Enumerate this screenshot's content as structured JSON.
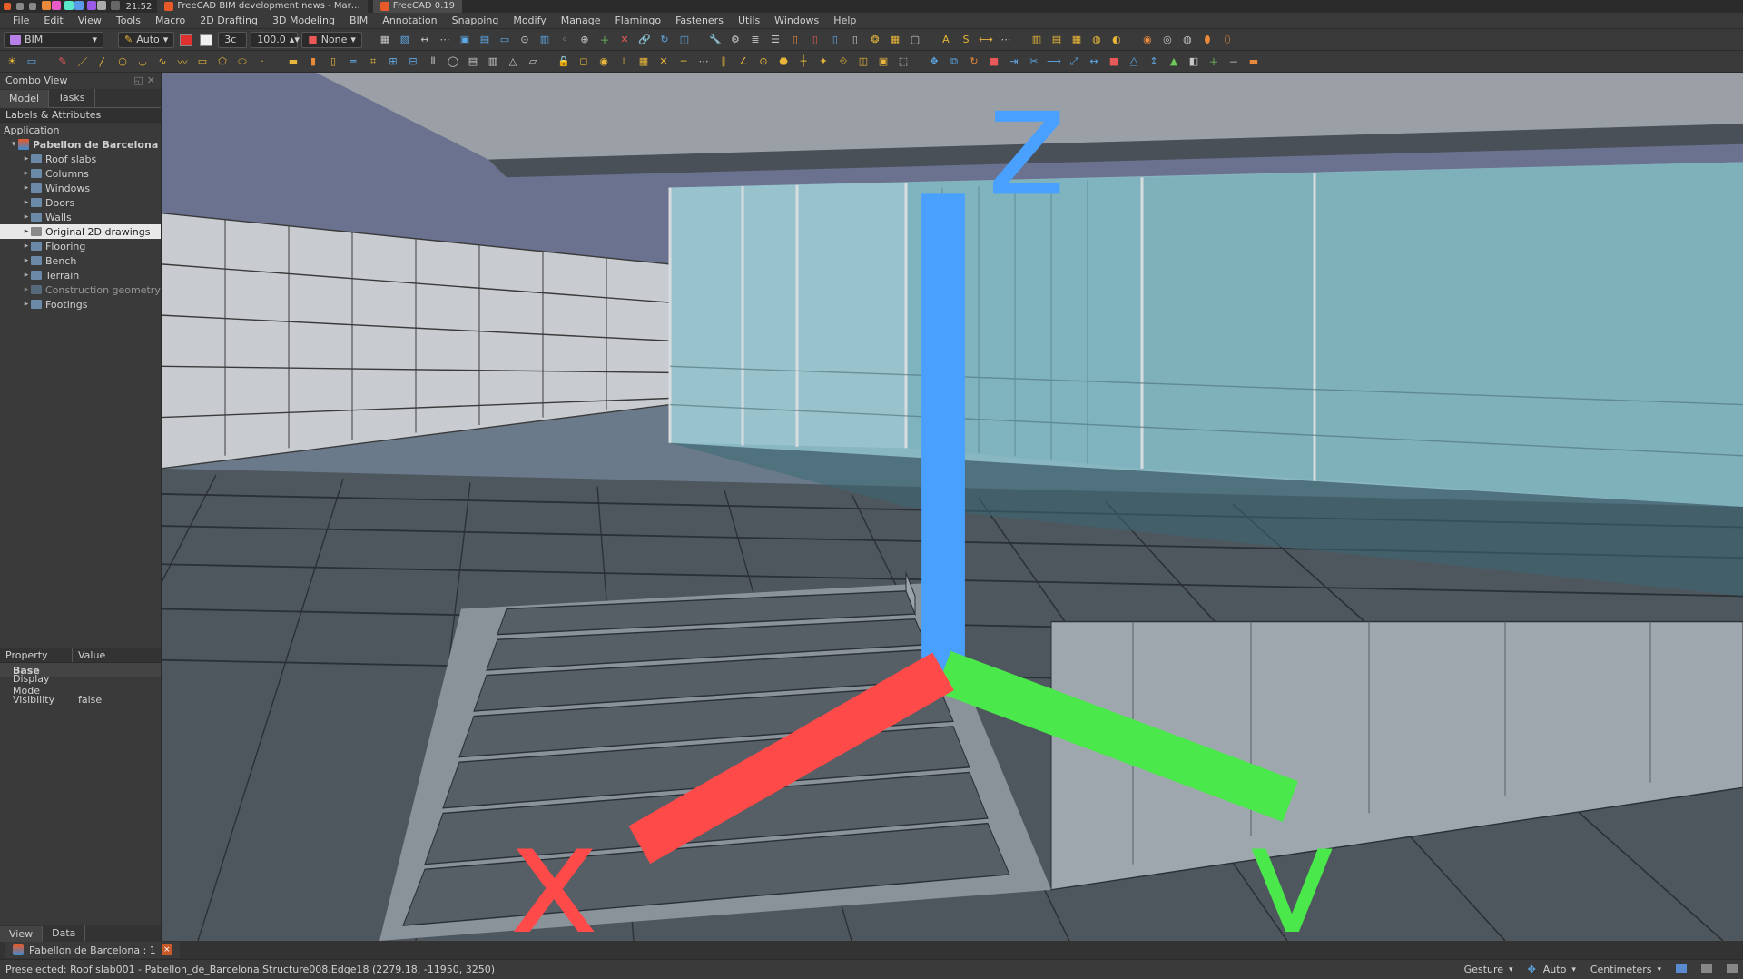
{
  "system": {
    "time": "21:52",
    "tab1": "FreeCAD BIM development news - Mar…",
    "tab2": "FreeCAD 0.19"
  },
  "menus": [
    "File",
    "Edit",
    "View",
    "Tools",
    "Macro",
    "2D Drafting",
    "3D Modeling",
    "BIM",
    "Annotation",
    "Snapping",
    "Modify",
    "Manage",
    "Flamingo",
    "Fasteners",
    "Utils",
    "Windows",
    "Help"
  ],
  "workbench": {
    "selected": "BIM"
  },
  "toolbar1": {
    "auto_label": "Auto",
    "num_field": "3c",
    "scale_field": "100.0",
    "none_label": "None"
  },
  "combo": {
    "title": "Combo View",
    "tabs": [
      "Model",
      "Tasks"
    ],
    "active_tab": 0,
    "section_label": "Labels & Attributes",
    "root": "Application",
    "doc_name": "Pabellon de Barcelona",
    "tree": [
      {
        "label": "Roof slabs",
        "sel": false
      },
      {
        "label": "Columns",
        "sel": false
      },
      {
        "label": "Windows",
        "sel": false
      },
      {
        "label": "Doors",
        "sel": false
      },
      {
        "label": "Walls",
        "sel": false
      },
      {
        "label": "Original 2D drawings",
        "sel": true,
        "grey": true
      },
      {
        "label": "Flooring",
        "sel": false
      },
      {
        "label": "Bench",
        "sel": false
      },
      {
        "label": "Terrain",
        "sel": false
      },
      {
        "label": "Construction geometry",
        "sel": false,
        "dim": true
      },
      {
        "label": "Footings",
        "sel": false
      }
    ]
  },
  "props": {
    "col_property": "Property",
    "col_value": "Value",
    "group": "Base",
    "rows": [
      {
        "k": "Display Mode",
        "v": ""
      },
      {
        "k": "Visibility",
        "v": "false"
      }
    ],
    "bottom_tabs": [
      "View",
      "Data"
    ],
    "bottom_active": 0
  },
  "document_tab": {
    "label": "Pabellon de Barcelona : 1"
  },
  "status": {
    "message": "Preselected: Roof slab001 - Pabellon_de_Barcelona.Structure008.Edge18 (2279.18, -11950, 3250)",
    "nav_style": "Gesture",
    "snap_label": "Auto",
    "units": "Centimeters"
  },
  "axes": {
    "x": "x",
    "y": "y",
    "z": "z"
  }
}
